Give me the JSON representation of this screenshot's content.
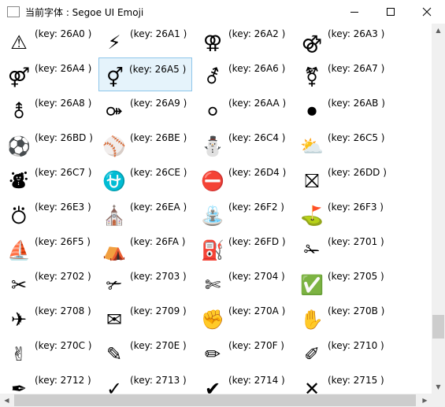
{
  "window": {
    "title": "当前字体 : Segoe UI Emoji",
    "minimize_icon": "minimize-icon",
    "maximize_icon": "maximize-icon",
    "close_icon": "close-icon"
  },
  "grid": {
    "selected_key": "26A5",
    "rows": [
      [
        {
          "glyph": "⚠",
          "label": "(key: 26A0 )"
        },
        {
          "glyph": "⚡",
          "label": "(key: 26A1 )"
        },
        {
          "glyph": "⚢",
          "label": "(key: 26A2 )"
        },
        {
          "glyph": "⚣",
          "label": "(key: 26A3 )"
        }
      ],
      [
        {
          "glyph": "⚤",
          "label": "(key: 26A4 )"
        },
        {
          "glyph": "⚥",
          "label": "(key: 26A5 )"
        },
        {
          "glyph": "⚦",
          "label": "(key: 26A6 )"
        },
        {
          "glyph": "⚧",
          "label": "(key: 26A7 )"
        }
      ],
      [
        {
          "glyph": "⚨",
          "label": "(key: 26A8 )"
        },
        {
          "glyph": "⚩",
          "label": "(key: 26A9 )"
        },
        {
          "glyph": "⚪",
          "label": "(key: 26AA )"
        },
        {
          "glyph": "⚫",
          "label": "(key: 26AB )"
        }
      ],
      [
        {
          "glyph": "⚽",
          "label": "(key: 26BD )"
        },
        {
          "glyph": "⚾",
          "label": "(key: 26BE )"
        },
        {
          "glyph": "⛄",
          "label": "(key: 26C4 )"
        },
        {
          "glyph": "⛅",
          "label": "(key: 26C5 )"
        }
      ],
      [
        {
          "glyph": "⛇",
          "label": "(key: 26C7 )"
        },
        {
          "glyph": "⛎",
          "label": "(key: 26CE )"
        },
        {
          "glyph": "⛔",
          "label": "(key: 26D4 )"
        },
        {
          "glyph": "⛝",
          "label": "(key: 26DD )"
        }
      ],
      [
        {
          "glyph": "⛣",
          "label": "(key: 26E3 )"
        },
        {
          "glyph": "⛪",
          "label": "(key: 26EA )"
        },
        {
          "glyph": "⛲",
          "label": "(key: 26F2 )"
        },
        {
          "glyph": "⛳",
          "label": "(key: 26F3 )"
        }
      ],
      [
        {
          "glyph": "⛵",
          "label": "(key: 26F5 )"
        },
        {
          "glyph": "⛺",
          "label": "(key: 26FA )"
        },
        {
          "glyph": "⛽",
          "label": "(key: 26FD )"
        },
        {
          "glyph": "✁",
          "label": "(key: 2701 )"
        }
      ],
      [
        {
          "glyph": "✂",
          "label": "(key: 2702 )"
        },
        {
          "glyph": "✃",
          "label": "(key: 2703 )"
        },
        {
          "glyph": "✄",
          "label": "(key: 2704 )"
        },
        {
          "glyph": "✅",
          "label": "(key: 2705 )"
        }
      ],
      [
        {
          "glyph": "✈",
          "label": "(key: 2708 )"
        },
        {
          "glyph": "✉",
          "label": "(key: 2709 )"
        },
        {
          "glyph": "✊",
          "label": "(key: 270A )"
        },
        {
          "glyph": "✋",
          "label": "(key: 270B )"
        }
      ],
      [
        {
          "glyph": "✌",
          "label": "(key: 270C )"
        },
        {
          "glyph": "✎",
          "label": "(key: 270E )"
        },
        {
          "glyph": "✏",
          "label": "(key: 270F )"
        },
        {
          "glyph": "✐",
          "label": "(key: 2710 )"
        }
      ],
      [
        {
          "glyph": "✒",
          "label": "(key: 2712 )"
        },
        {
          "glyph": "✓",
          "label": "(key: 2713 )"
        },
        {
          "glyph": "✔",
          "label": "(key: 2714 )"
        },
        {
          "glyph": "✕",
          "label": "(key: 2715 )"
        }
      ]
    ]
  },
  "scrollbars": {
    "vertical_up_icon": "scroll-up-arrow-icon",
    "vertical_down_icon": "scroll-down-arrow-icon",
    "horizontal_left_icon": "scroll-left-arrow-icon",
    "horizontal_right_icon": "scroll-right-arrow-icon"
  }
}
